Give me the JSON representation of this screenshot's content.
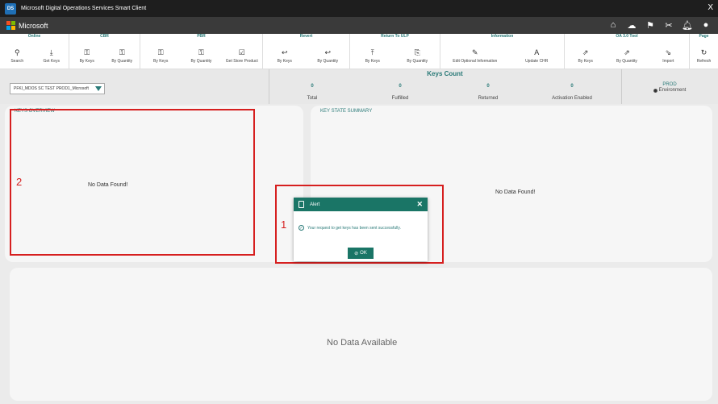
{
  "titlebar": {
    "app_icon": "DS",
    "title": "Microsoft Digital Operations Services Smart Client",
    "close": "X"
  },
  "brandbar": {
    "brand": "Microsoft",
    "icons": [
      "home-icon",
      "cloud-icon",
      "flag-icon",
      "tools-icon",
      "bell-icon",
      "user-icon"
    ]
  },
  "ribbon": {
    "groups": [
      {
        "title": "Online",
        "items": [
          {
            "label": "Search",
            "icon": "search-icon"
          },
          {
            "label": "Get Keys",
            "icon": "download-icon"
          }
        ]
      },
      {
        "title": "CBR",
        "items": [
          {
            "label": "By Keys",
            "icon": "keys-icon"
          },
          {
            "label": "By Quantity",
            "icon": "quantity-icon"
          }
        ]
      },
      {
        "title": "PBR",
        "items": [
          {
            "label": "By Keys",
            "icon": "keys-icon"
          },
          {
            "label": "By Quantity",
            "icon": "quantity-icon"
          },
          {
            "label": "Get Store Product",
            "icon": "checklist-icon"
          }
        ]
      },
      {
        "title": "Revert",
        "items": [
          {
            "label": "By Keys",
            "icon": "reply-icon"
          },
          {
            "label": "By Quantity",
            "icon": "reply-icon"
          }
        ]
      },
      {
        "title": "Return To ULP",
        "items": [
          {
            "label": "By Keys",
            "icon": "upload-icon"
          },
          {
            "label": "By Quantity",
            "icon": "return-icon"
          }
        ]
      },
      {
        "title": "Information",
        "items": [
          {
            "label": "Edit Optional Information",
            "icon": "edit-icon"
          },
          {
            "label": "Update CHR",
            "icon": "font-edit-icon"
          }
        ]
      },
      {
        "title": "OA 3.0 Tool",
        "items": [
          {
            "label": "By Keys",
            "icon": "external-icon"
          },
          {
            "label": "By Quantity",
            "icon": "external-icon"
          },
          {
            "label": "Import",
            "icon": "import-icon"
          }
        ]
      },
      {
        "title": "Page",
        "items": [
          {
            "label": "Refresh",
            "icon": "refresh-icon"
          }
        ]
      }
    ]
  },
  "strip": {
    "dropdown_value": "PFKI_MDOS SC TEST PROD1_Microsoft",
    "keys_count_title": "Keys Count",
    "stats": [
      {
        "value": "0",
        "label": "Total"
      },
      {
        "value": "0",
        "label": "Fulfilled"
      },
      {
        "value": "0",
        "label": "Returned"
      },
      {
        "value": "0",
        "label": "Activation Enabled"
      }
    ],
    "environment": {
      "value": "PROD",
      "label": "Environment"
    }
  },
  "panels": {
    "keys_overview": {
      "title": "KEYS OVERVIEW",
      "empty": "No Data Found!"
    },
    "key_state_summary": {
      "title": "KEY STATE SUMMARY",
      "empty": "No Data Found!"
    },
    "bottom": {
      "empty": "No Data Available"
    }
  },
  "annotations": {
    "label1": "1",
    "label2": "2",
    "color": "#d61f1f"
  },
  "alert": {
    "title": "Alert",
    "close": "✕",
    "message": "Your request to get keys has been sent successfully.",
    "ok_label": "OK"
  },
  "colors": {
    "accent": "#1a7566",
    "teal_text": "#2a7a78"
  }
}
